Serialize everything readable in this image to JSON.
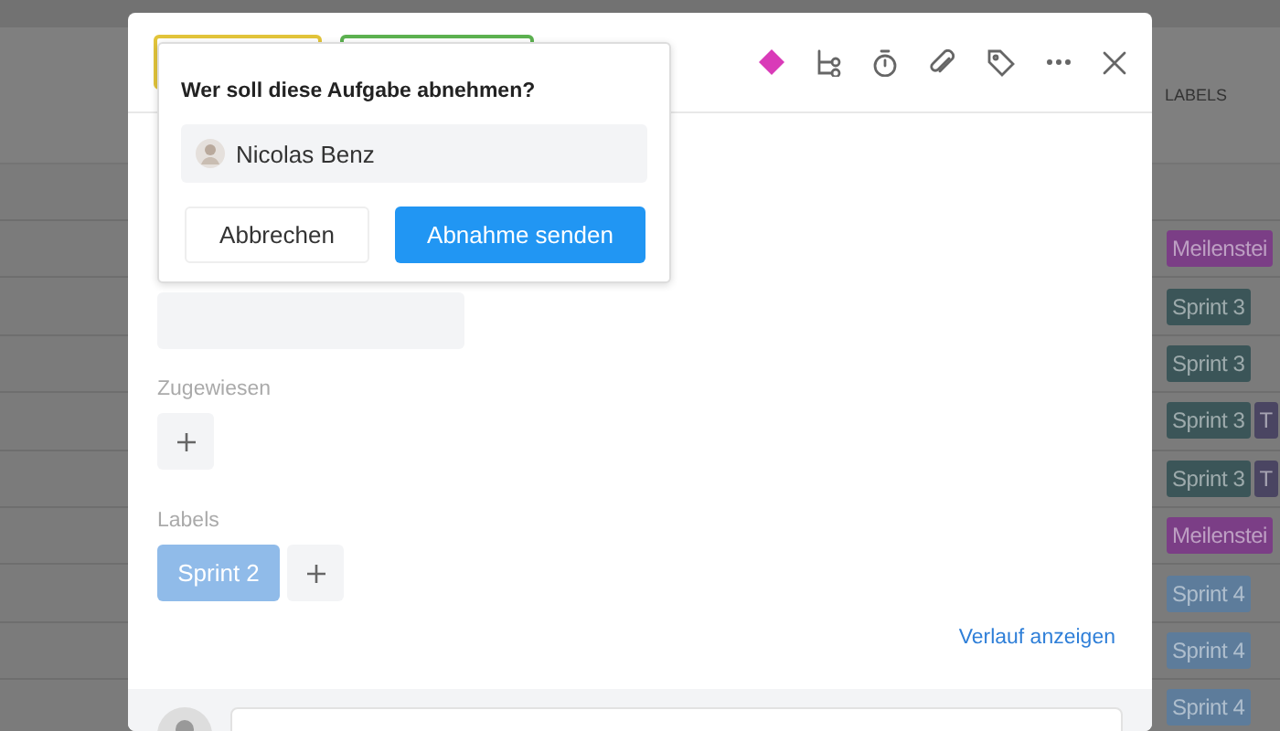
{
  "background_table": {
    "column_header": "LABELS",
    "rows": [
      {
        "labels": [
          {
            "text": "Meilenstei",
            "color": "#7b3e86"
          }
        ]
      },
      {
        "labels": [
          {
            "text": "Sprint 3",
            "color": "#3b5558"
          }
        ]
      },
      {
        "labels": [
          {
            "text": "Sprint 3",
            "color": "#3b5558"
          }
        ]
      },
      {
        "labels": [
          {
            "text": "Sprint 3",
            "color": "#3b5558"
          },
          {
            "text": "T",
            "color": "#4a4562"
          }
        ]
      },
      {
        "labels": [
          {
            "text": "Sprint 3",
            "color": "#3b5558"
          },
          {
            "text": "T",
            "color": "#4a4562"
          }
        ]
      },
      {
        "labels": [
          {
            "text": "Meilenstei",
            "color": "#7b3e86"
          }
        ]
      },
      {
        "labels": [
          {
            "text": "Sprint 4",
            "color": "#5d7c9b"
          }
        ]
      },
      {
        "labels": [
          {
            "text": "Sprint 4",
            "color": "#5d7c9b"
          }
        ]
      },
      {
        "labels": [
          {
            "text": "Sprint 4",
            "color": "#5d7c9b"
          }
        ]
      }
    ]
  },
  "task_dialog": {
    "status_buttons": [
      {
        "color": "#e2c43a"
      },
      {
        "color": "#5cb150"
      }
    ],
    "fields": [
      {
        "kind": "blank"
      },
      {
        "kind": "assignees",
        "label": "Zugewiesen"
      },
      {
        "kind": "labels",
        "label": "Labels",
        "labels": [
          {
            "text": "Sprint 2",
            "color": "#90bbe9"
          }
        ]
      }
    ],
    "history_link": "Verlauf anzeigen"
  },
  "approval_popover": {
    "question": "Wer soll diese Aufgabe abnehmen?",
    "person": "Nicolas Benz",
    "buttons": [
      {
        "label": "Abbrechen",
        "kind": "secondary"
      },
      {
        "label": "Abnahme senden",
        "kind": "primary"
      }
    ]
  }
}
